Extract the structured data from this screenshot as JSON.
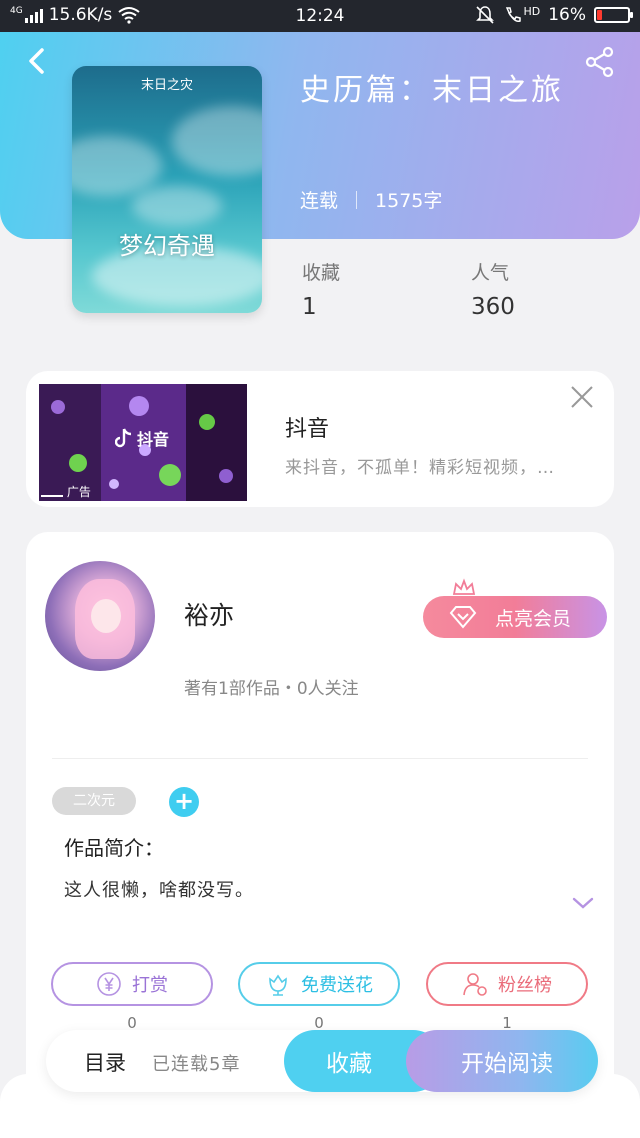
{
  "status_bar": {
    "network": "4G",
    "speed": "15.6K/s",
    "time": "12:24",
    "hd": "HD",
    "battery": "16%",
    "battery_level": 0.16
  },
  "book": {
    "cover_top_title": "末日之灾",
    "cover_main_title": "梦幻奇遇",
    "title": "史历篇：末日之旅",
    "status": "连载",
    "word_count": "1575字",
    "stats": [
      {
        "label": "收藏",
        "value": "1"
      },
      {
        "label": "人气",
        "value": "360"
      }
    ]
  },
  "ad": {
    "brand": "抖音",
    "label": "广告",
    "title": "抖音",
    "description": "来抖音，不孤单！精彩短视频，…"
  },
  "author": {
    "name": "裕亦",
    "vip_button": "点亮会员",
    "summary": "著有1部作品・0人关注",
    "tag": "二次元",
    "add_tag": "+",
    "intro_label": "作品简介：",
    "intro_text": "这人很懒，啥都没写。"
  },
  "actions": [
    {
      "label": "打赏",
      "count": "0",
      "icon": "yen-icon"
    },
    {
      "label": "免费送花",
      "count": "0",
      "icon": "flower-icon"
    },
    {
      "label": "粉丝榜",
      "count": "1",
      "icon": "user-rank-icon"
    }
  ],
  "bottom_bar": {
    "toc_label": "目录",
    "toc_status": "已连载5章",
    "favorite_button": "收藏",
    "read_button": "开始阅读"
  },
  "colors": {
    "accent_blue": "#4fd0f0",
    "accent_purple": "#b89ce6",
    "vip_pink": "#f27d98"
  }
}
